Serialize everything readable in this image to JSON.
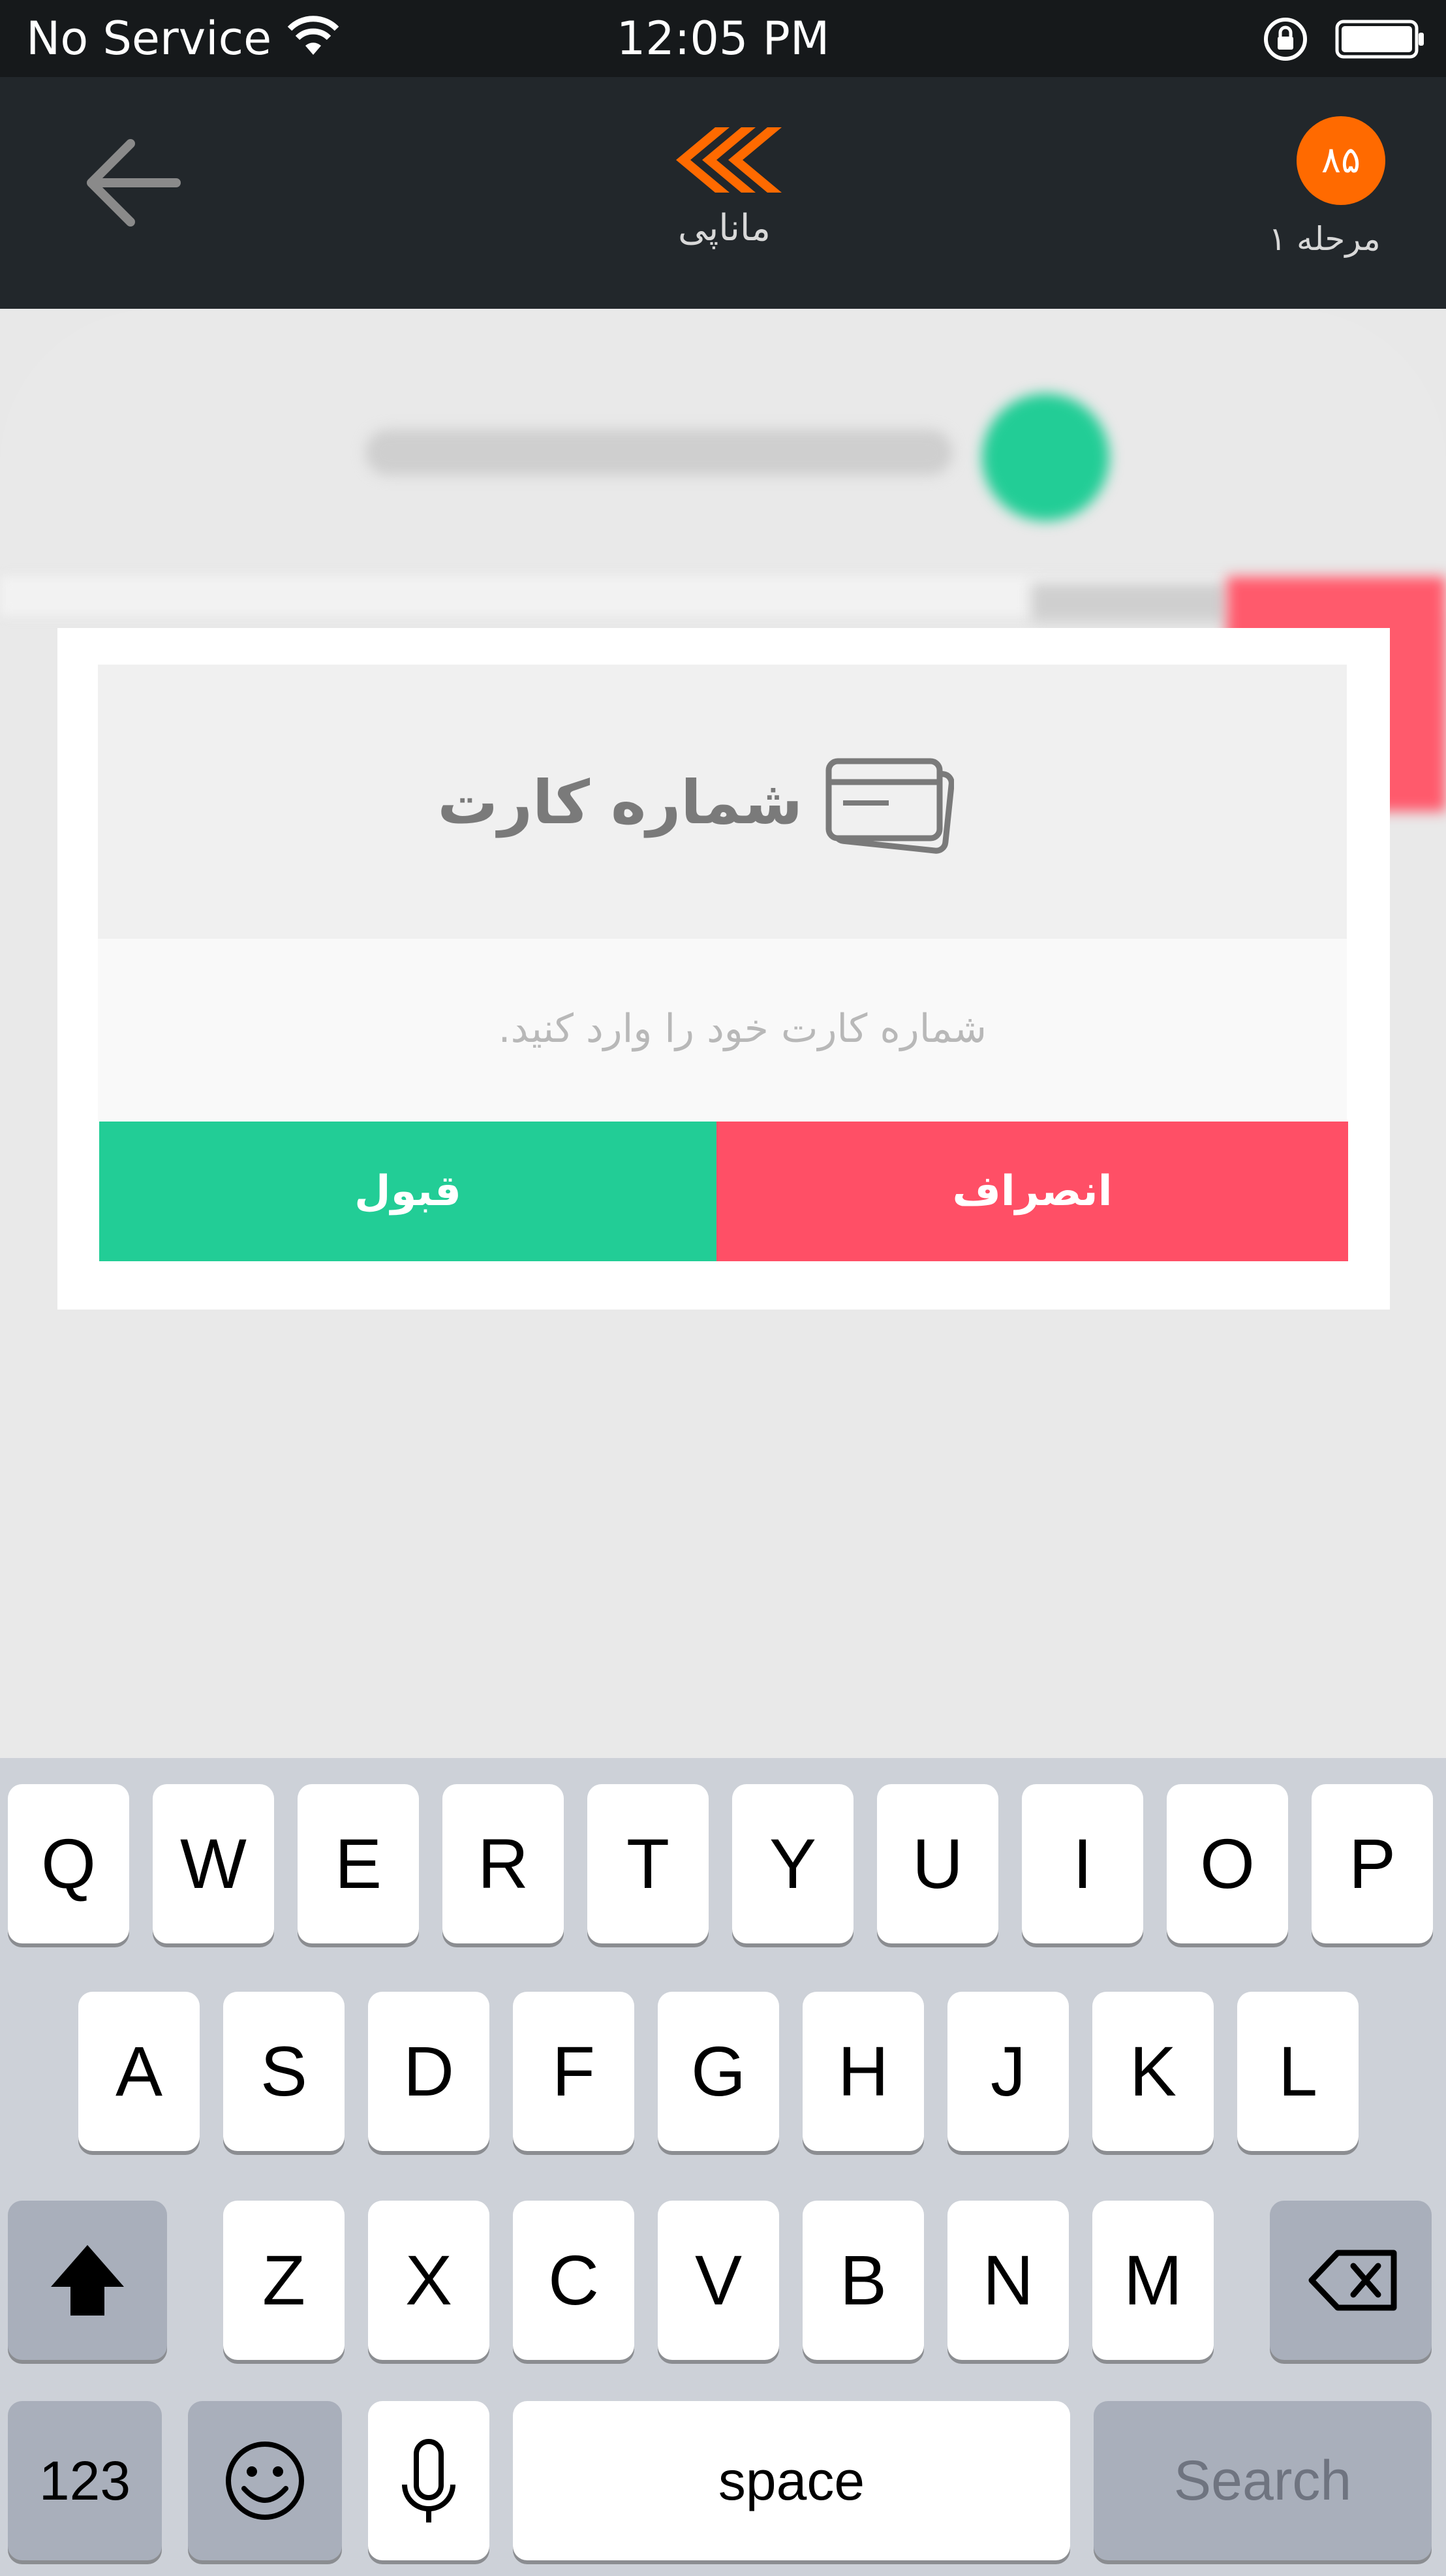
{
  "status_bar": {
    "carrier": "No Service",
    "time": "12:05 PM"
  },
  "nav": {
    "app_name": "ماناپی",
    "level_badge": "۸۵",
    "level_label": "مرحله ۱",
    "icons": {
      "back": "back-arrow-icon",
      "logo": "manapay-logo-icon"
    }
  },
  "dialog": {
    "title": "شماره کارت",
    "input_placeholder": "شماره کارت خود را وارد کنید.",
    "accept_label": "قبول",
    "cancel_label": "انصراف",
    "icon": "credit-card-icon"
  },
  "keyboard": {
    "row1": [
      "Q",
      "W",
      "E",
      "R",
      "T",
      "Y",
      "U",
      "I",
      "O",
      "P"
    ],
    "row2": [
      "A",
      "S",
      "D",
      "F",
      "G",
      "H",
      "J",
      "K",
      "L"
    ],
    "row3": [
      "Z",
      "X",
      "C",
      "V",
      "B",
      "N",
      "M"
    ],
    "numbers_label": "123",
    "space_label": "space",
    "search_label": "Search"
  },
  "colors": {
    "accent": "#ff6a00",
    "accept": "#22cd96",
    "cancel": "#ff4f66",
    "nav_bg": "#22272b"
  }
}
